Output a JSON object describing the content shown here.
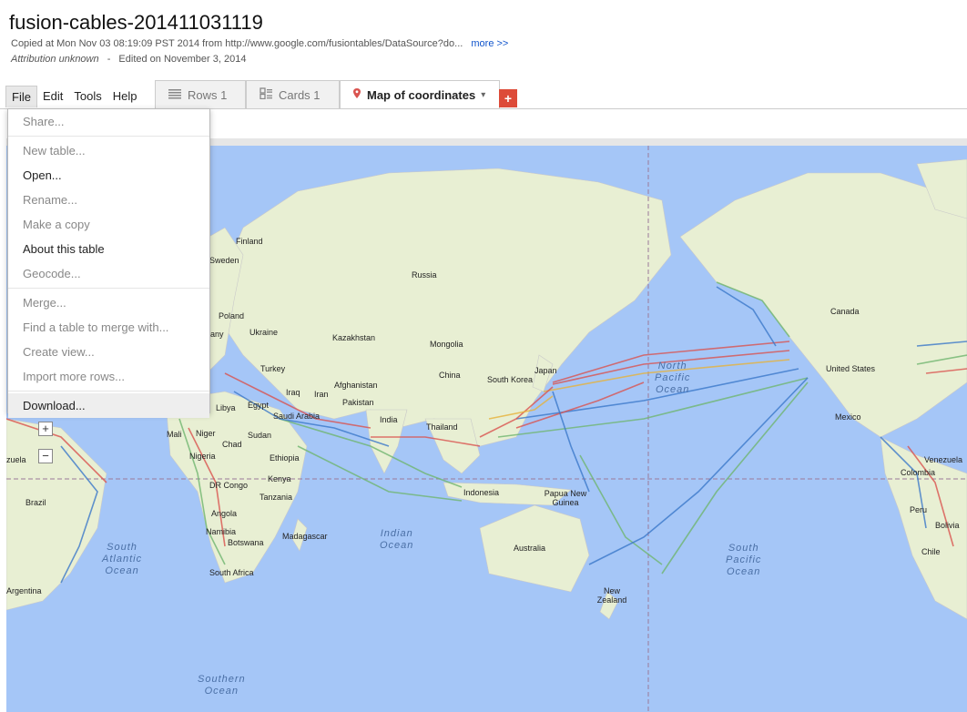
{
  "header": {
    "title": "fusion-cables-201411031119",
    "copied": "Copied at Mon Nov 03 08:19:09 PST 2014 from http://www.google.com/fusiontables/DataSource?do...",
    "more_link": "more >>",
    "attribution": "Attribution unknown",
    "separator": "-",
    "edited": "Edited on November 3, 2014"
  },
  "menubar": [
    "File",
    "Edit",
    "Tools",
    "Help"
  ],
  "tabs": [
    {
      "label": "Rows 1",
      "icon": "rows-icon"
    },
    {
      "label": "Cards 1",
      "icon": "cards-icon"
    },
    {
      "label": "Map of coordinates",
      "icon": "map-pin-icon",
      "caret": "▾"
    }
  ],
  "add_tab_label": "+",
  "file_menu": {
    "groups": [
      [
        {
          "label": "Share...",
          "enabled": false
        }
      ],
      [
        {
          "label": "New table...",
          "enabled": false
        },
        {
          "label": "Open...",
          "enabled": true
        },
        {
          "label": "Rename...",
          "enabled": false
        },
        {
          "label": "Make a copy",
          "enabled": false
        },
        {
          "label": "About this table",
          "enabled": true
        },
        {
          "label": "Geocode...",
          "enabled": false
        }
      ],
      [
        {
          "label": "Merge...",
          "enabled": false
        },
        {
          "label": "Find a table to merge with...",
          "enabled": false
        },
        {
          "label": "Create view...",
          "enabled": false
        },
        {
          "label": "Import more rows...",
          "enabled": false
        }
      ],
      [
        {
          "label": "Download...",
          "enabled": true,
          "hover": true
        }
      ]
    ]
  },
  "map": {
    "zoom_in": "+",
    "zoom_out": "−",
    "places": [
      "Finland",
      "Sweden",
      "Russia",
      "Poland",
      "Ukraine",
      "Kazakhstan",
      "Mongolia",
      "Turkey",
      "China",
      "South Korea",
      "Japan",
      "Iraq",
      "Iran",
      "Afghanistan",
      "Pakistan",
      "Egypt",
      "Libya",
      "Saudi Arabia",
      "India",
      "Thailand",
      "Mali",
      "Niger",
      "Chad",
      "Sudan",
      "Nigeria",
      "Ethiopia",
      "Kenya",
      "DR Congo",
      "Tanzania",
      "Angola",
      "Namibia",
      "Botswana",
      "Madagascar",
      "South Africa",
      "Indonesia",
      "Papua New Guinea",
      "Australia",
      "New Zealand",
      "Canada",
      "United States",
      "Mexico",
      "Venezuela",
      "Colombia",
      "Peru",
      "Bolivia",
      "Chile",
      "Brazil",
      "Argentina",
      "zuela",
      "any"
    ],
    "oceans": [
      {
        "name": "North Pacific Ocean"
      },
      {
        "name": "Indian Ocean"
      },
      {
        "name": "South Atlantic Ocean"
      },
      {
        "name": "South Pacific Ocean"
      },
      {
        "name": "Southern Ocean"
      }
    ],
    "colors": {
      "water": "#a5c6f7",
      "land": "#e8f0d4",
      "cable_red": "#d9534f",
      "cable_green": "#6fb56f",
      "cable_blue": "#3b78c9",
      "cable_yellow": "#e6b23a"
    }
  }
}
